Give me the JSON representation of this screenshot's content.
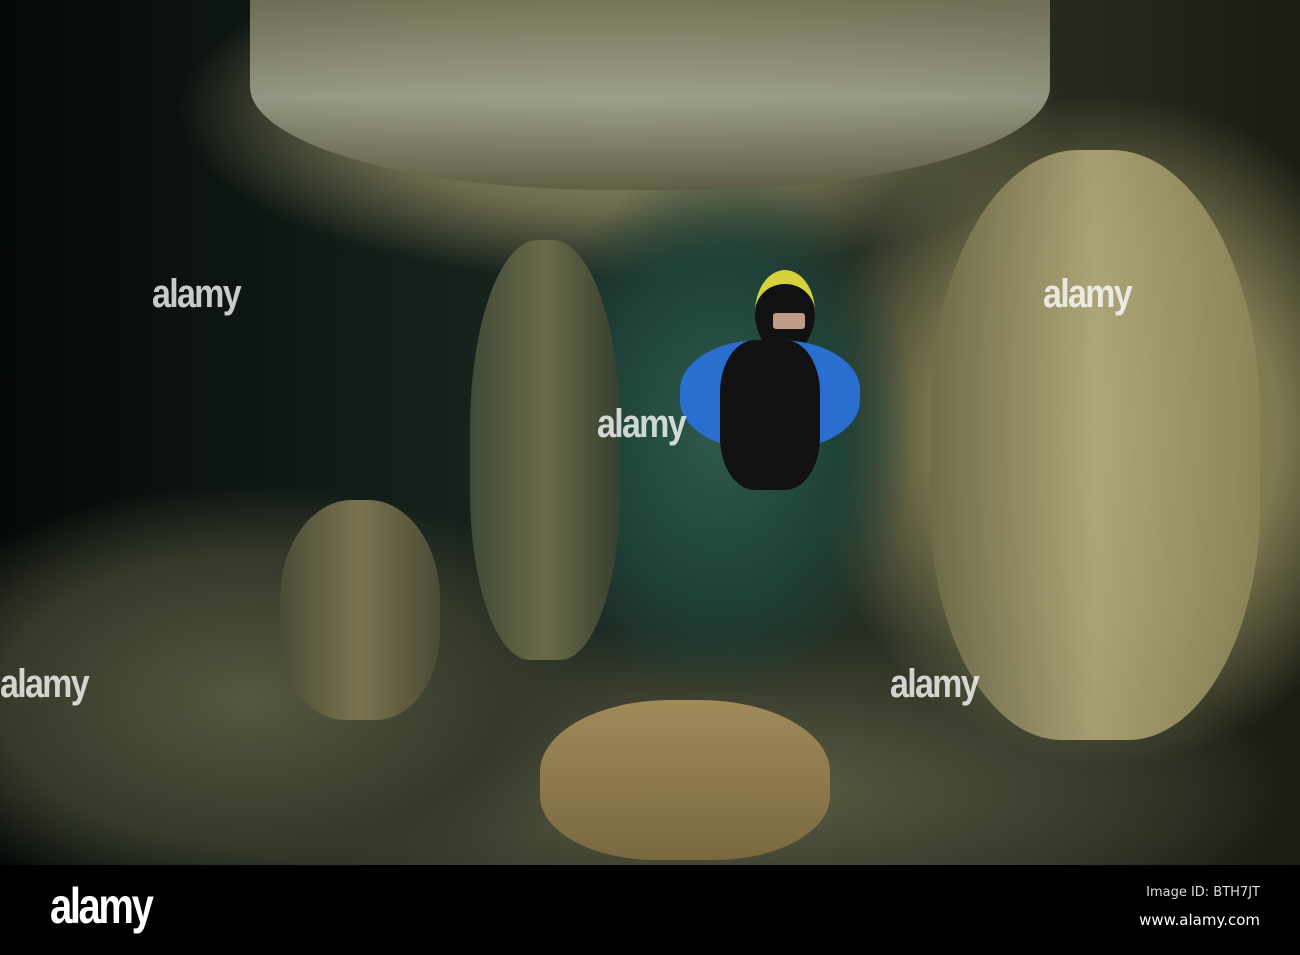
{
  "photo": {
    "subject": "cave diver",
    "watermark_text": "alamy"
  },
  "footer": {
    "logo": "alamy",
    "image_id": "Image ID: BTH7JT",
    "website": "www.alamy.com"
  }
}
